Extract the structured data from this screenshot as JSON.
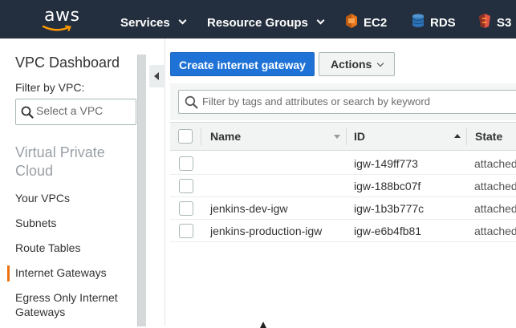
{
  "topnav": {
    "logo_text": "aws",
    "services_label": "Services",
    "resource_groups_label": "Resource Groups",
    "pinned": [
      {
        "label": "EC2",
        "icon": "ec2-icon",
        "color": "#e7731b"
      },
      {
        "label": "RDS",
        "icon": "rds-icon",
        "color": "#2e73b8"
      },
      {
        "label": "S3",
        "icon": "s3-icon",
        "color": "#e25444"
      }
    ],
    "background": "#232f3e"
  },
  "sidebar": {
    "title": "VPC Dashboard",
    "filter_label": "Filter by VPC:",
    "filter_placeholder": "Select a VPC",
    "section_title": "Virtual Private Cloud",
    "items": [
      {
        "label": "Your VPCs",
        "active": false
      },
      {
        "label": "Subnets",
        "active": false
      },
      {
        "label": "Route Tables",
        "active": false
      },
      {
        "label": "Internet Gateways",
        "active": true
      },
      {
        "label": "Egress Only Internet Gateways",
        "active": false
      }
    ],
    "active_color": "#ec7211"
  },
  "toolbar": {
    "create_label": "Create internet gateway",
    "actions_label": "Actions",
    "primary_color": "#1f73d6"
  },
  "search": {
    "placeholder": "Filter by tags and attributes or search by keyword"
  },
  "table": {
    "columns": [
      "Name",
      "ID",
      "State"
    ],
    "rows": [
      {
        "name": "",
        "id": "igw-149ff773",
        "state": "attached"
      },
      {
        "name": "",
        "id": "igw-188bc07f",
        "state": "attached"
      },
      {
        "name": "jenkins-dev-igw",
        "id": "igw-1b3b777c",
        "state": "attached"
      },
      {
        "name": "jenkins-production-igw",
        "id": "igw-e6b4fb81",
        "state": "attached"
      }
    ]
  }
}
